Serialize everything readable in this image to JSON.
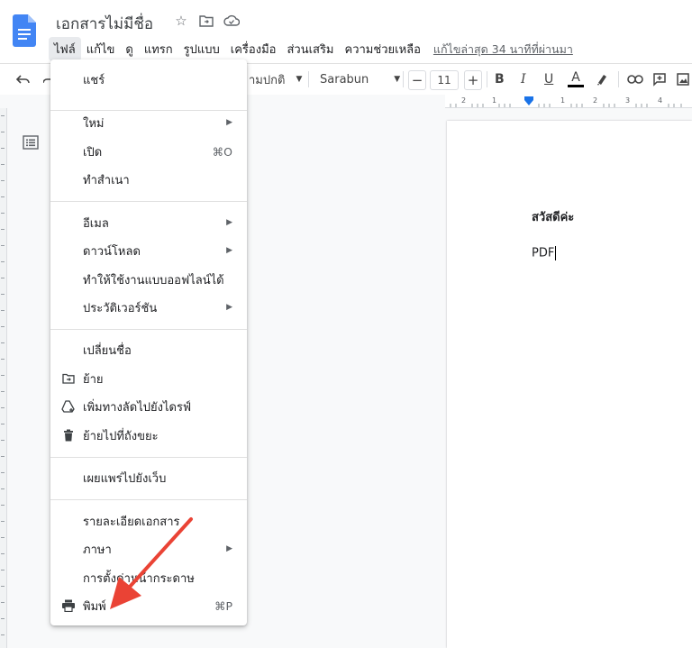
{
  "header": {
    "title": "เอกสารไม่มีชื่อ",
    "menus": [
      "ไฟล์",
      "แก้ไข",
      "ดู",
      "แทรก",
      "รูปแบบ",
      "เครื่องมือ",
      "ส่วนเสริม",
      "ความช่วยเหลือ"
    ],
    "last_edit": "แก้ไขล่าสุด 34 นาทีที่ผ่านมา"
  },
  "toolbar": {
    "style_partial": "ามปกติ",
    "font": "Sarabun",
    "font_size": "11",
    "bold": "B",
    "italic": "I",
    "underline": "U",
    "text_color": "A"
  },
  "ruler": {
    "labels": [
      "2",
      "1",
      "1",
      "2",
      "3",
      "4"
    ]
  },
  "document": {
    "greeting": "สวัสดีค่ะ",
    "text": "PDF"
  },
  "file_menu": {
    "share": "แชร์",
    "new": "ใหม่",
    "open": "เปิด",
    "open_shortcut": "⌘O",
    "make_copy": "ทำสำเนา",
    "email": "อีเมล",
    "download": "ดาวน์โหลด",
    "offline": "ทำให้ใช้งานแบบออฟไลน์ได้",
    "version_history": "ประวัติเวอร์ชัน",
    "rename": "เปลี่ยนชื่อ",
    "move": "ย้าย",
    "add_shortcut": "เพิ่มทางลัดไปยังไดรฟ์",
    "trash": "ย้ายไปที่ถังขยะ",
    "publish": "เผยแพร่ไปยังเว็บ",
    "details": "รายละเอียดเอกสาร",
    "language": "ภาษา",
    "page_setup": "การตั้งค่าหน้ากระดาษ",
    "print": "พิมพ์",
    "print_shortcut": "⌘P"
  },
  "colors": {
    "doc_blue": "#4285f4",
    "annotation_red": "#ea4335",
    "accent": "#1a73e8"
  }
}
